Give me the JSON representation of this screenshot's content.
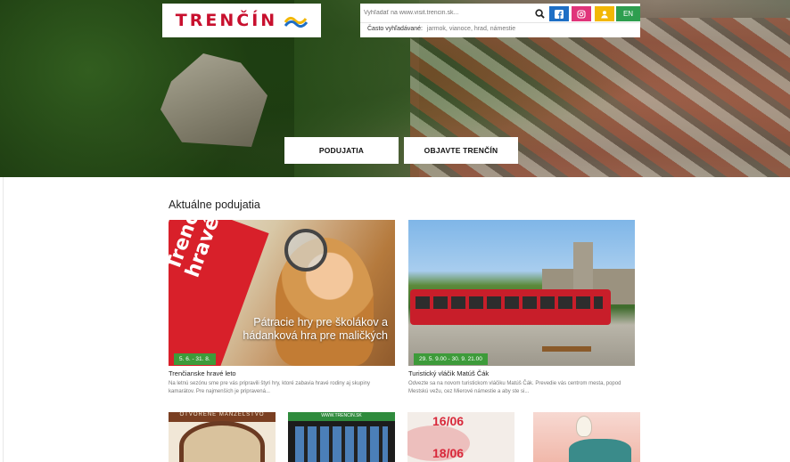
{
  "header": {
    "logo_text": "TRENČÍN",
    "logo_icon": "trencin-wave-logo",
    "search": {
      "placeholder": "Vyhľadať na www.visit.trencin.sk...",
      "often_label": "Často vyhľadávané:",
      "often_tags": "jarmok, vianoce, hrad, námestie"
    },
    "icons": [
      "search-icon",
      "facebook-icon",
      "instagram-icon",
      "user-icon"
    ],
    "language": "EN",
    "colors": {
      "logo": "#c8102e",
      "facebook": "#1f6fc5",
      "instagram": "#e0357a",
      "user": "#f2b705",
      "lang": "#2e9e4f"
    }
  },
  "hero": {
    "buttons": {
      "events": "PODUJATIA",
      "discover": "OBJAVTE TRENČÍN"
    }
  },
  "main": {
    "section_title": "Aktuálne podujatia",
    "cards": [
      {
        "image_ribbon": "Trenčianske hravé leto",
        "image_caption": "Pátracie hry pre školákov a hádanková hra pre maličkých",
        "date": "5. 6. - 31. 8.",
        "title": "Trenčianske hravé leto",
        "desc": "Na letnú sezónu sme pre vás pripravili štyri hry, ktoré zabavia hravé rodiny aj skupiny kamarátov. Pre najmenších je pripravená..."
      },
      {
        "date": "29. 5. 9.00 - 30. 9. 21.00",
        "title": "Turistický vláčik Matúš Čák",
        "desc": "Odvezte sa na novom turistickom vláčiku Matúš Čák. Prevedie vás centrom mesta, popod Mestskú vežu, cez Mierové námestie a aby ste si..."
      }
    ],
    "thumbs": [
      {
        "text": "OTVORENÉ MANŽELSTVO"
      },
      {
        "text": "WWW.TRENCIN.SK"
      },
      {
        "text1": "16/06",
        "text2": "18/06"
      },
      {
        "text": ""
      }
    ],
    "accent": "#3d9b3a"
  }
}
